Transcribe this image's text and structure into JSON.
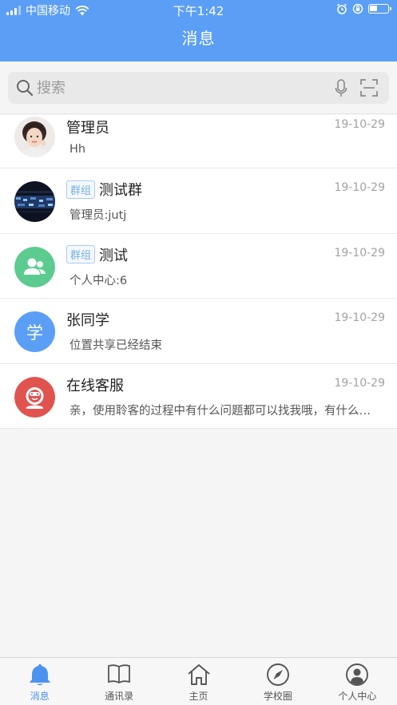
{
  "status_bar": {
    "carrier": "中国移动",
    "time": "下午1:42",
    "battery_level": 0.45
  },
  "header": {
    "title": "消息"
  },
  "search": {
    "placeholder": "搜索"
  },
  "conversations": [
    {
      "name": "管理员",
      "tag": "",
      "preview": "Hh",
      "time": "19-10-29",
      "avatar": "photo-avatar"
    },
    {
      "name": "测试群",
      "tag": "群组",
      "preview": "管理员:jutj",
      "time": "19-10-29",
      "avatar": "group-photo-avatar"
    },
    {
      "name": "测试",
      "tag": "群组",
      "preview": "个人中心:6",
      "time": "19-10-29",
      "avatar": "group-icon-avatar",
      "avatar_color": "#5ccb8f"
    },
    {
      "name": "张同学",
      "tag": "",
      "preview": "位置共享已经结束",
      "time": "19-10-29",
      "avatar": "letter-avatar",
      "avatar_letter": "学",
      "avatar_color": "#5b9ef6"
    },
    {
      "name": "在线客服",
      "tag": "",
      "preview": "亲，使用聆客的过程中有什么问题都可以找我哦，有什么问题都可以找我哦",
      "time": "19-10-29",
      "avatar": "support-avatar",
      "avatar_color": "#e0534f"
    }
  ],
  "tabbar": {
    "active_tab": "消息",
    "tabs": [
      {
        "label": "消息",
        "icon": "bell-icon"
      },
      {
        "label": "通讯录",
        "icon": "book-icon"
      },
      {
        "label": "主页",
        "icon": "home-icon"
      },
      {
        "label": "学校圈",
        "icon": "compass-icon"
      },
      {
        "label": "个人中心",
        "icon": "user-circle-icon"
      }
    ]
  },
  "colors": {
    "primary": "#5b9ef6",
    "tab_active": "#4c93f0",
    "tag_text": "#7ab0e8"
  }
}
